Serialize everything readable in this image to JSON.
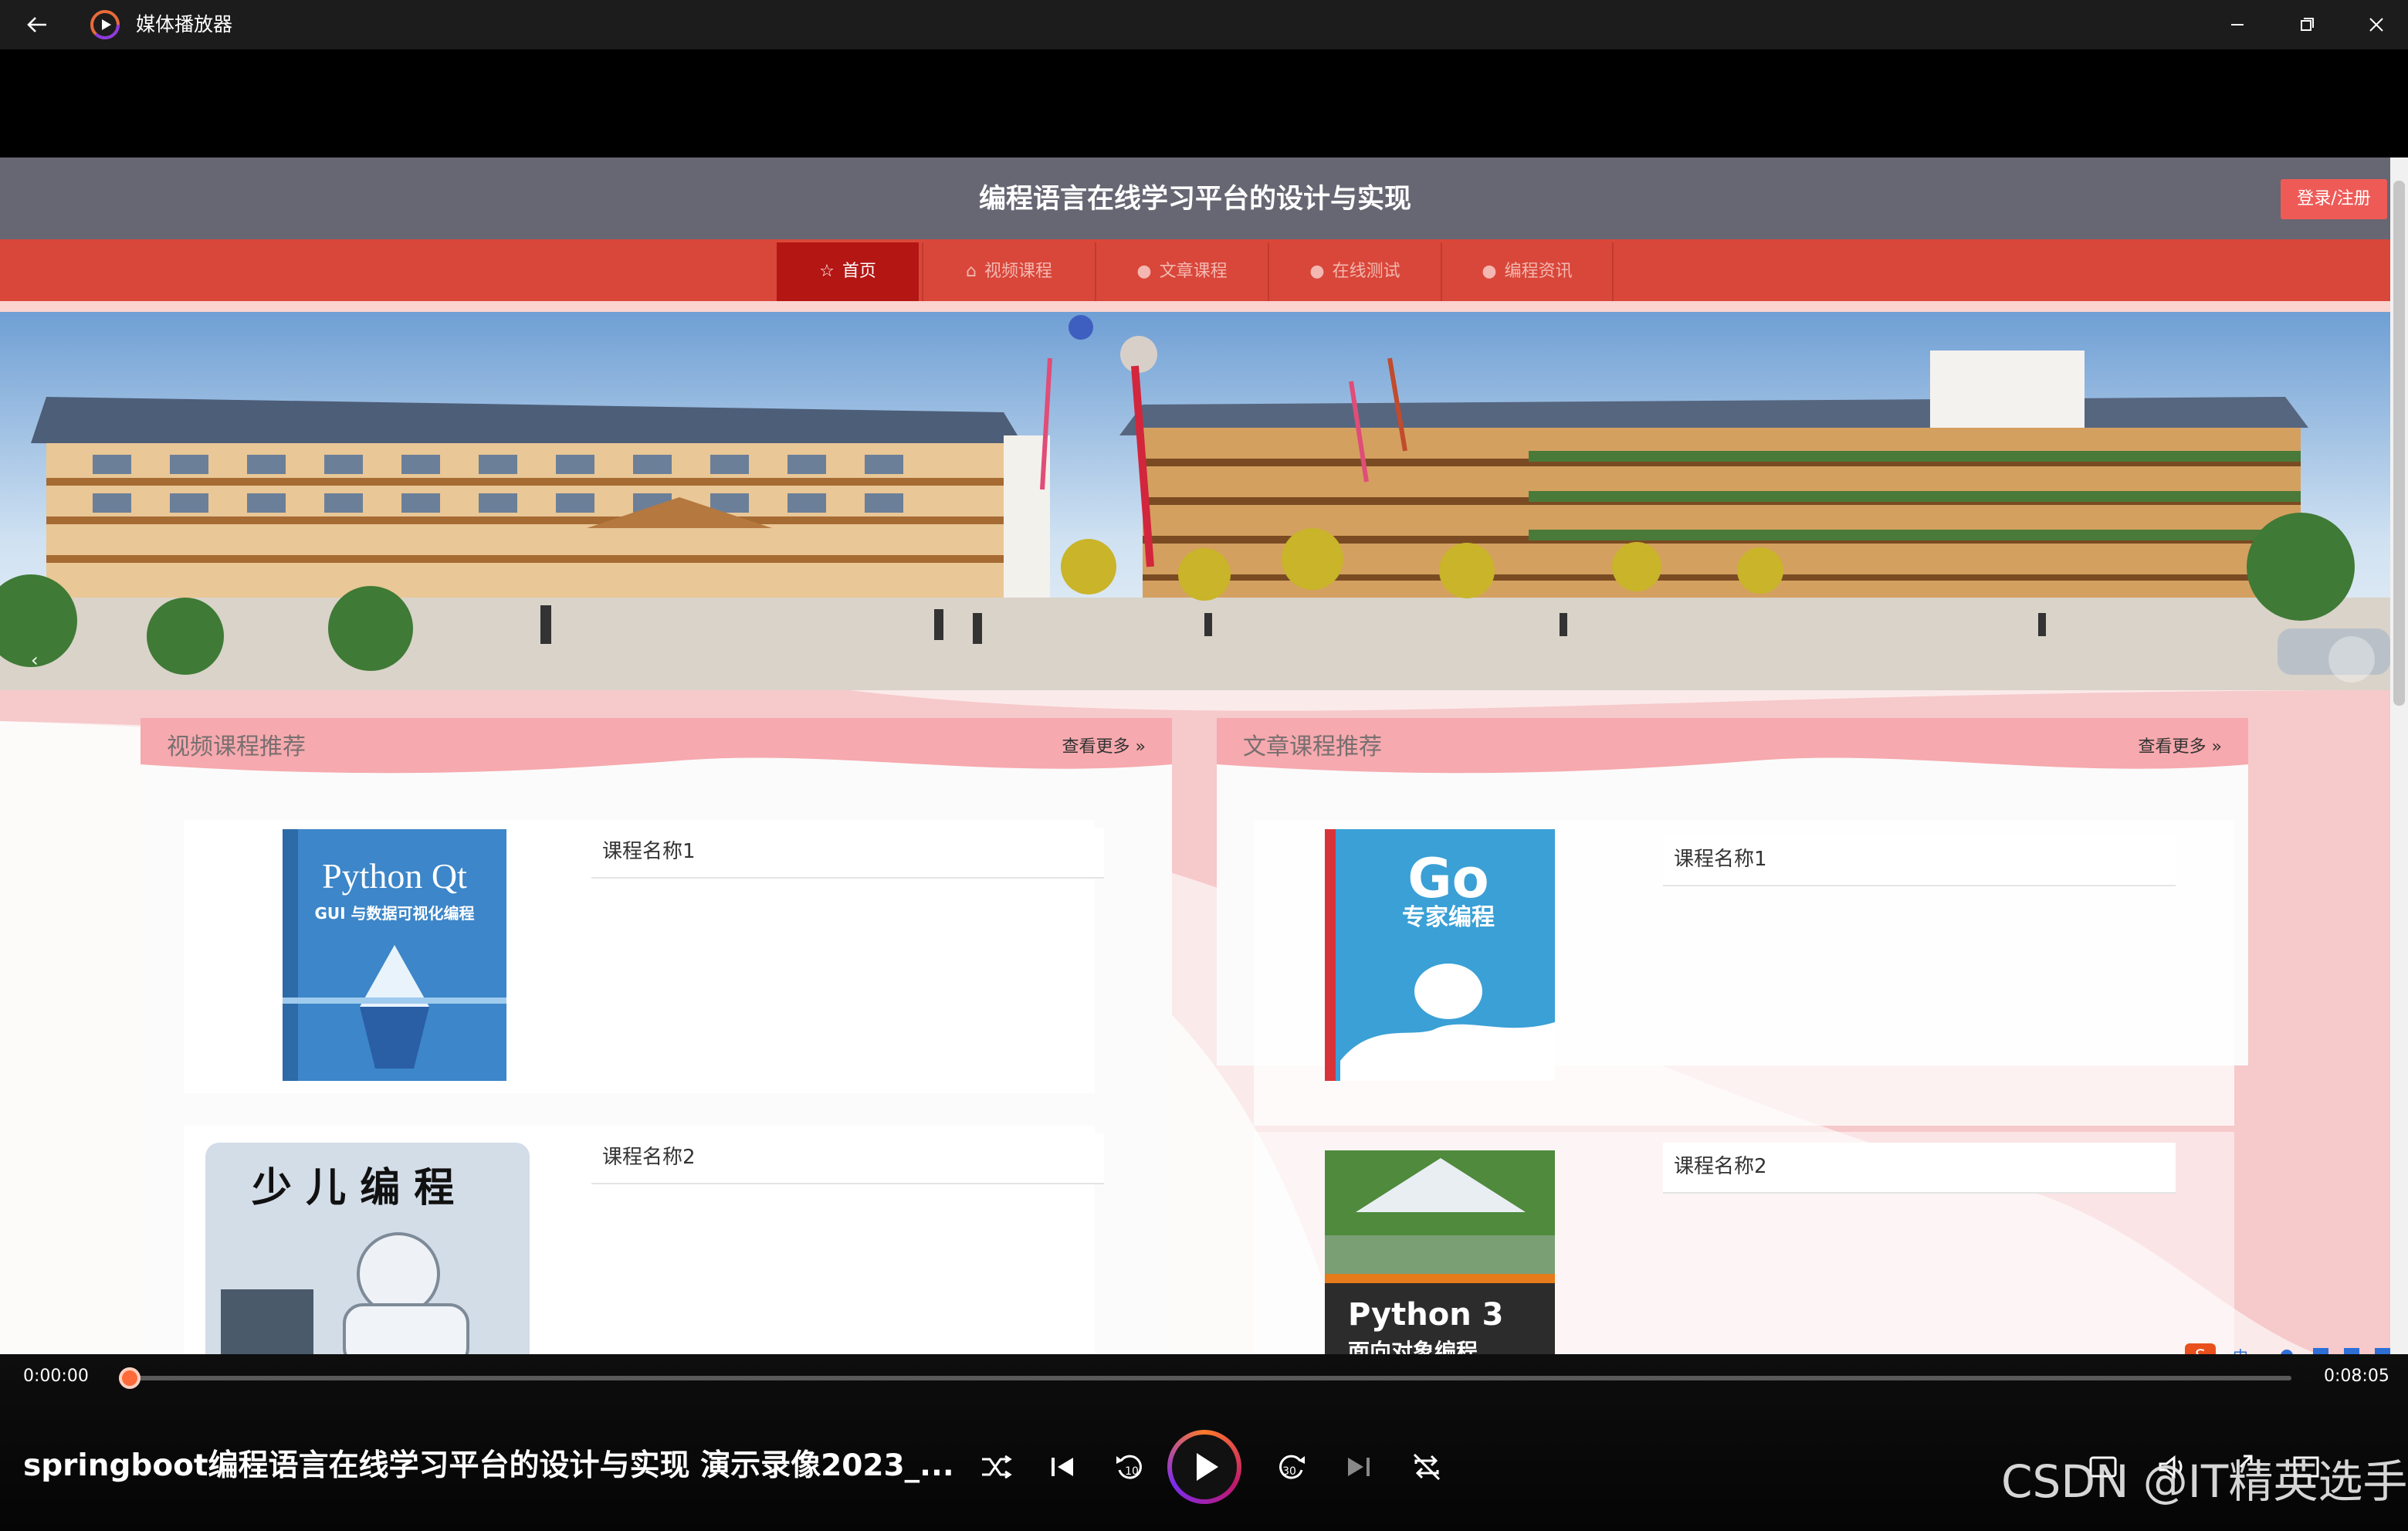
{
  "app": {
    "title": "媒体播放器"
  },
  "site": {
    "title": "编程语言在线学习平台的设计与实现",
    "login": "登录/注册",
    "nav": [
      {
        "label": "首页",
        "icon": "star-icon"
      },
      {
        "label": "视频课程",
        "icon": "bag-icon"
      },
      {
        "label": "文章课程",
        "icon": "info-icon"
      },
      {
        "label": "在线测试",
        "icon": "question-icon"
      },
      {
        "label": "编程资讯",
        "icon": "info-icon"
      }
    ],
    "sections": [
      {
        "title": "视频课程推荐",
        "more": "查看更多 »",
        "items": [
          {
            "name": "课程名称1",
            "cover": "Python Qt",
            "subtitle": "GUI 与数据可视化编程"
          },
          {
            "name": "课程名称2",
            "cover": "少儿编程"
          }
        ]
      },
      {
        "title": "文章课程推荐",
        "more": "查看更多 »",
        "items": [
          {
            "name": "课程名称1",
            "cover": "Go",
            "subtitle": "专家编程"
          },
          {
            "name": "课程名称2",
            "cover": "Python 3",
            "subtitle": "面向对象编程"
          }
        ]
      }
    ]
  },
  "player": {
    "current_time": "0:00:00",
    "total_time": "0:08:05",
    "progress": 0.0,
    "media_title": "springboot编程语言在线学习平台的设计与实现  演示录像2023_...",
    "skip_back": "10",
    "skip_forward": "30"
  },
  "watermark": "CSDN @IT精英选手",
  "colors": {
    "accent": "#d9473a",
    "active_nav": "#b41613",
    "header": "#676673",
    "progress": "#ff6a3a"
  }
}
